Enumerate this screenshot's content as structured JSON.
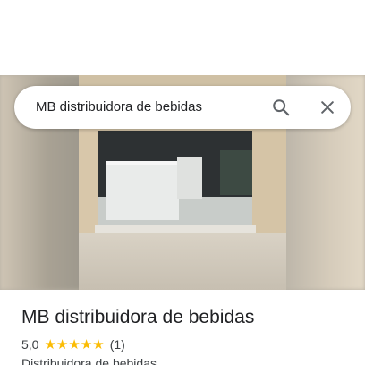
{
  "search": {
    "query": "MB distribuidora de bebidas",
    "search_icon": "search-icon",
    "close_icon": "close-icon"
  },
  "photo": {
    "subject": "storefront-photo"
  },
  "place": {
    "name": "MB distribuidora de bebidas",
    "rating": "5,0",
    "stars": 5,
    "reviews": "(1)",
    "category": "Distribuidora de bebidas"
  },
  "colors": {
    "star": "#fbbc04",
    "text_primary": "#202124",
    "text_secondary": "#3c4043"
  }
}
